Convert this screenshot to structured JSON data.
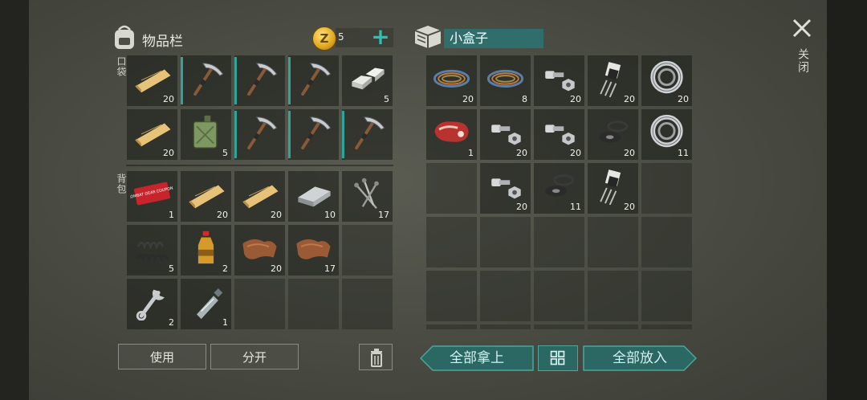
{
  "header": {
    "inventory_title": "物品栏",
    "coins": "5",
    "container_title": "小盒子",
    "close_label": "关闭"
  },
  "sections": {
    "pocket_label": "口袋",
    "backpack_label": "背包"
  },
  "inventory_pocket": [
    {
      "item": "wood-plank-icon",
      "count": "20"
    },
    {
      "item": "pickaxe-icon",
      "count": ""
    },
    {
      "item": "pickaxe-icon",
      "count": ""
    },
    {
      "item": "pickaxe-icon",
      "count": ""
    },
    {
      "item": "metal-ingot-icon",
      "count": "5"
    },
    {
      "item": "wood-plank-icon",
      "count": "20"
    },
    {
      "item": "jerrycan-icon",
      "count": "5"
    },
    {
      "item": "pickaxe-icon",
      "count": ""
    },
    {
      "item": "pickaxe-icon",
      "count": ""
    },
    {
      "item": "pickaxe-icon",
      "count": ""
    }
  ],
  "inventory_backpack": [
    {
      "item": "coupon-icon",
      "count": "1"
    },
    {
      "item": "wood-plank-icon",
      "count": "20"
    },
    {
      "item": "wood-plank-icon",
      "count": "20"
    },
    {
      "item": "iron-bar-icon",
      "count": "10"
    },
    {
      "item": "nails-icon",
      "count": "17"
    },
    {
      "item": "spring-icon",
      "count": "5"
    },
    {
      "item": "bottle-icon",
      "count": "2"
    },
    {
      "item": "leather-icon",
      "count": "20"
    },
    {
      "item": "leather-icon",
      "count": "17"
    },
    {
      "item": "",
      "count": ""
    },
    {
      "item": "wrench-icon",
      "count": "2"
    },
    {
      "item": "plastic-bottle-icon",
      "count": "1"
    },
    {
      "item": "",
      "count": ""
    },
    {
      "item": "",
      "count": ""
    },
    {
      "item": "",
      "count": ""
    }
  ],
  "container_items": [
    {
      "item": "wire-icon",
      "count": "20"
    },
    {
      "item": "wire-icon",
      "count": "8"
    },
    {
      "item": "bolt-nut-icon",
      "count": "20"
    },
    {
      "item": "transistor-icon",
      "count": "20"
    },
    {
      "item": "bearing-icon",
      "count": "20"
    },
    {
      "item": "meat-icon",
      "count": "1"
    },
    {
      "item": "bolt-nut-icon",
      "count": "20"
    },
    {
      "item": "bolt-nut-icon",
      "count": "20"
    },
    {
      "item": "washer-icon",
      "count": "20"
    },
    {
      "item": "bearing-icon",
      "count": "11"
    },
    {
      "item": "",
      "count": ""
    },
    {
      "item": "bolt-nut-icon",
      "count": "20"
    },
    {
      "item": "washer-icon",
      "count": "11"
    },
    {
      "item": "transistor-icon",
      "count": "20"
    },
    {
      "item": "",
      "count": ""
    }
  ],
  "coupon_text": "COMBAT GEAR COUPON",
  "buttons": {
    "use": "使用",
    "split": "分开",
    "take_all": "全部拿上",
    "put_all": "全部放入"
  },
  "colors": {
    "accent": "#27c3b3",
    "container_title_bg": "#2f6e6a",
    "durability": "#2fa59a"
  }
}
